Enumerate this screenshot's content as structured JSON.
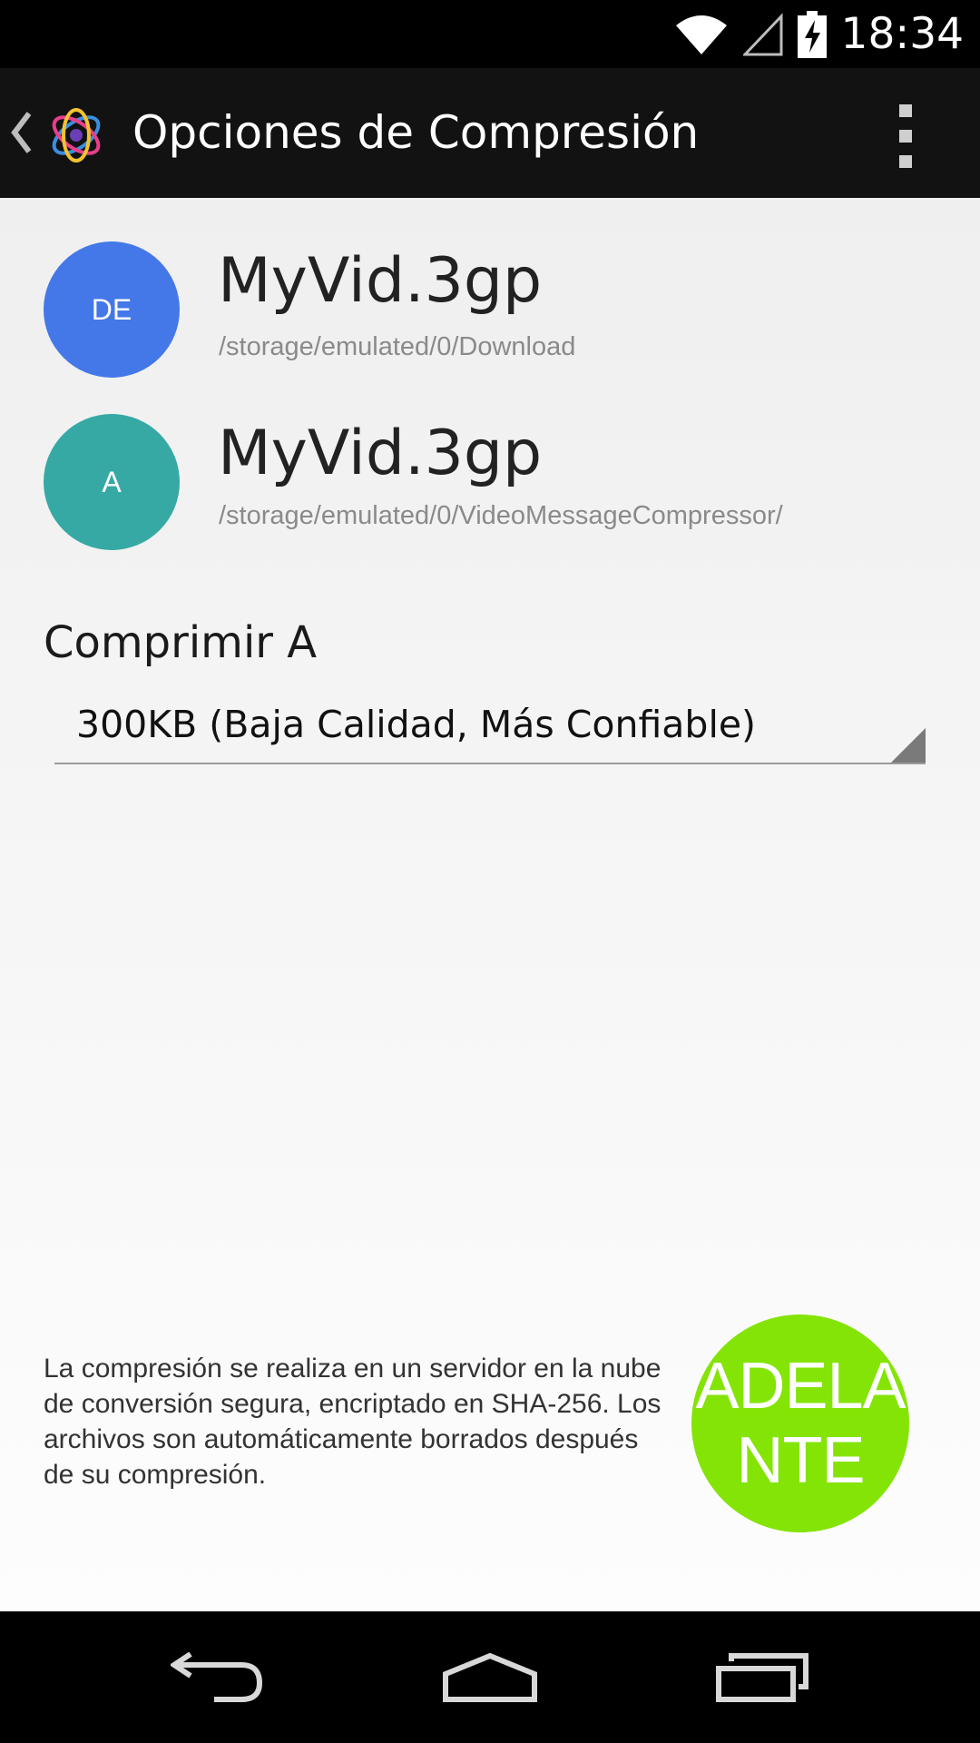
{
  "status_bar": {
    "time": "18:34"
  },
  "action_bar": {
    "title": "Opciones de Compresión"
  },
  "files": [
    {
      "avatar_label": "DE",
      "avatar_color": "#4478e8",
      "name": "MyVid.3gp",
      "path": "/storage/emulated/0/Download"
    },
    {
      "avatar_label": "A",
      "avatar_color": "#36a9a5",
      "name": "MyVid.3gp",
      "path": "/storage/emulated/0/VideoMessageCompressor/"
    }
  ],
  "compress": {
    "label": "Comprimir A",
    "selected_option": "300KB (Baja Calidad, Más Confiable)"
  },
  "info": {
    "text": "La compresión se realiza en un servidor en la nube de conversión segura, encriptado en SHA-256. Los archivos son automáticamente borrados después de su compresión."
  },
  "go_button": {
    "label": "ADELANTE",
    "color": "#84e406"
  },
  "nav": {
    "back": "back-icon",
    "home": "home-icon",
    "recents": "recents-icon"
  }
}
